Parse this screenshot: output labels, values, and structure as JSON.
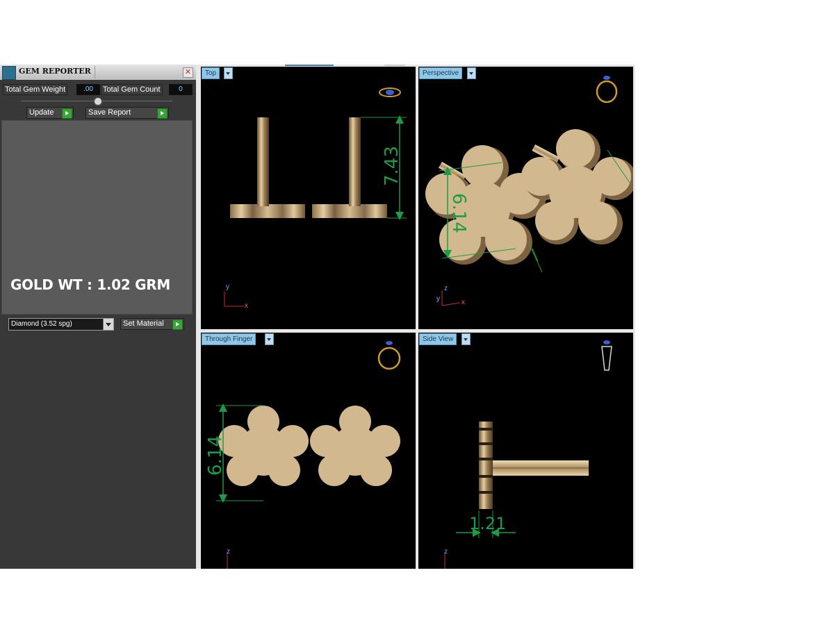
{
  "gem_reporter": {
    "title": "GEM REPORTER",
    "close_symbol": "✕",
    "total_gem_weight_label": "Total Gem Weight",
    "total_gem_weight_value": ".00",
    "total_gem_count_label": "Total Gem Count",
    "total_gem_count_value": "0",
    "update_label": "Update",
    "save_report_label": "Save Report",
    "report_text": "GOLD WT : 1.02 GRM",
    "material_selected": "Diamond     (3.52 spg)",
    "set_material_label": "Set Material"
  },
  "viewports": {
    "top": {
      "label": "Top",
      "dimension": "7.43",
      "axis_v": "y",
      "axis_h": "x",
      "nav_icon": "ring-top-icon"
    },
    "perspective": {
      "label": "Perspective",
      "dimension": "6.14",
      "axis_v": "z",
      "axis_h": "x",
      "axis_d": "y",
      "nav_icon": "ring-perspective-icon"
    },
    "through_finger": {
      "label": "Through Finger",
      "dimension": "6.14",
      "axis_v": "z",
      "nav_icon": "ring-front-icon"
    },
    "side_view": {
      "label": "Side View",
      "dimension": "1.21",
      "axis_v": "z",
      "nav_icon": "ring-side-icon"
    }
  },
  "colors": {
    "gold": "#cdb08a",
    "dimension_green": "#1e9b46",
    "tab_blue": "#8ec7e8",
    "play_green": "#3aa43a"
  }
}
